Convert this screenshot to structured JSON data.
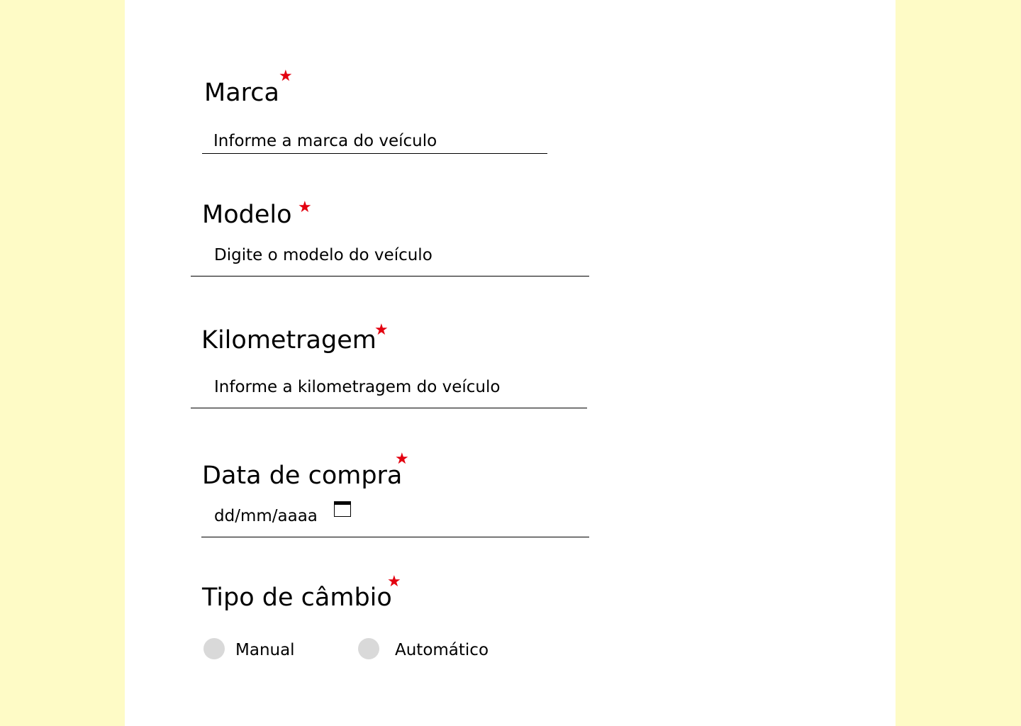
{
  "colors": {
    "page_background": "#FEFBC6",
    "panel_background": "#FFFFFF",
    "required_star": "#E3000F",
    "radio_fill": "#D9D9D9"
  },
  "required_marker": "★",
  "fields": {
    "marca": {
      "label": "Marca",
      "placeholder": "Informe a marca do veículo"
    },
    "modelo": {
      "label": "Modelo",
      "placeholder": "Digite o modelo do veículo"
    },
    "kilometragem": {
      "label": "Kilometragem",
      "placeholder": "Informe a kilometragem do veículo"
    },
    "data_compra": {
      "label": "Data de compra",
      "placeholder": "dd/mm/aaaa",
      "icon": "calendar-icon"
    },
    "tipo_cambio": {
      "label": "Tipo de câmbio",
      "options": [
        {
          "label": "Manual",
          "selected": false
        },
        {
          "label": "Automático",
          "selected": false
        }
      ]
    }
  }
}
